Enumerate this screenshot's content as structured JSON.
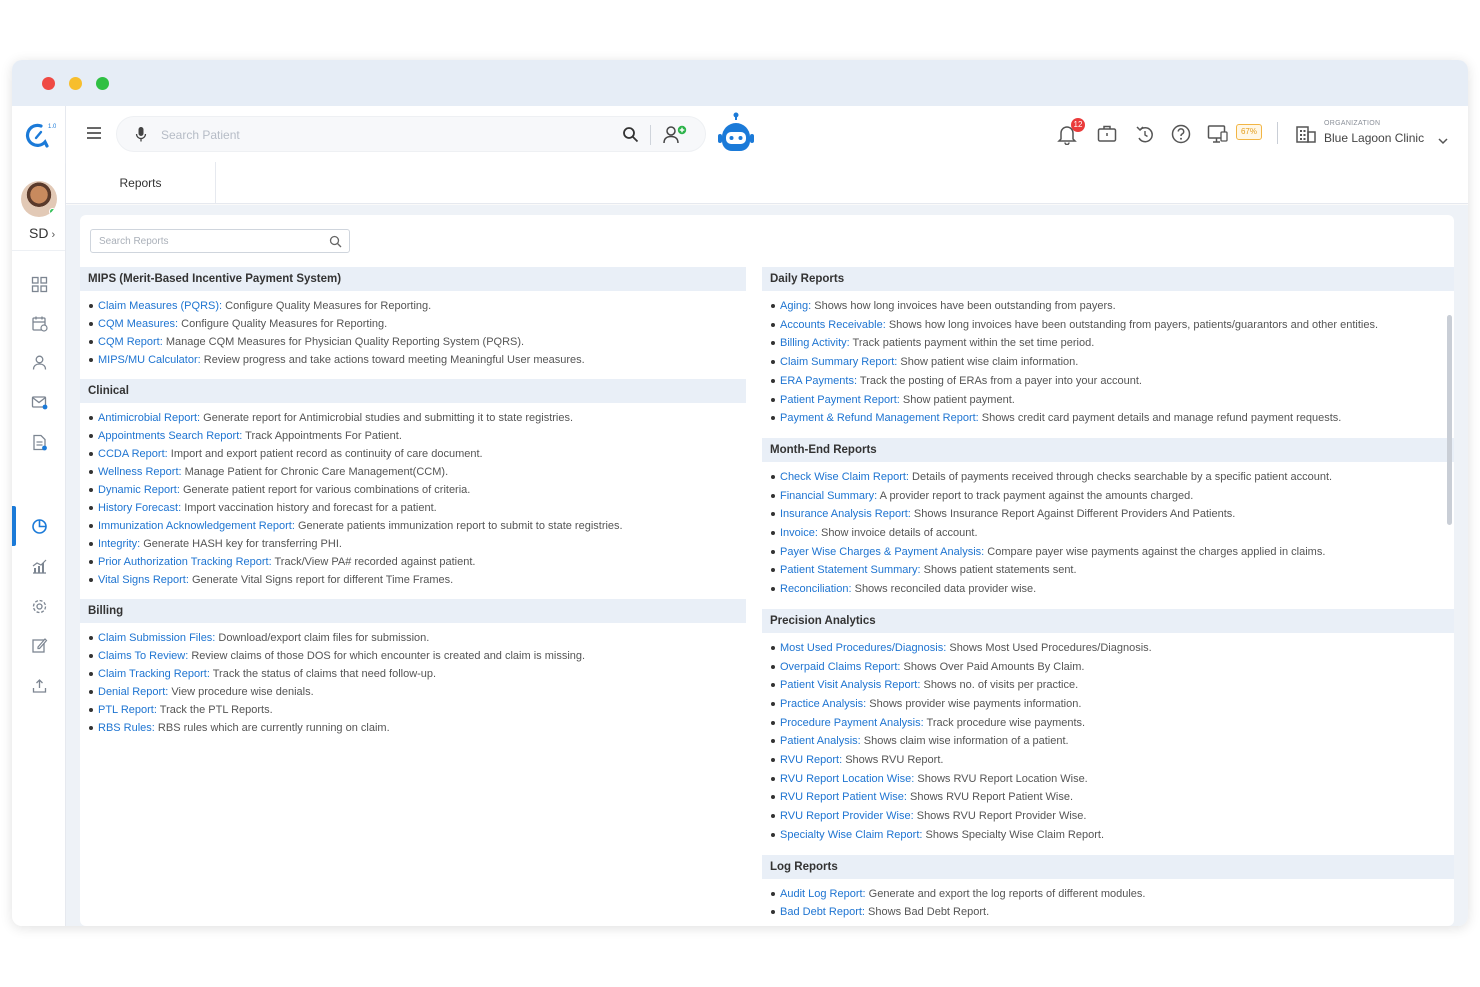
{
  "colors": {
    "accent": "#1e74d1",
    "section_header_bg": "#e9eff7",
    "content_bg": "#eef2f7",
    "notification_badge": "#ea3b3b"
  },
  "topbar": {
    "search_placeholder": "Search Patient",
    "notification_count": "12",
    "storage_percent": "67%",
    "organization_label": "ORGANIZATION",
    "organization_name": "Blue Lagoon Clinic"
  },
  "sidebar": {
    "user_initials": "SD",
    "nav_icons": [
      "dashboard-icon",
      "schedule-icon",
      "patient-icon",
      "messages-icon",
      "documents-icon",
      "reports-icon",
      "analytics-icon",
      "settings-icon",
      "edit-icon",
      "upload-icon"
    ],
    "active_item": "reports-icon"
  },
  "tabs": [
    {
      "label": "Reports"
    }
  ],
  "reports_search_placeholder": "Search Reports",
  "left_sections": [
    {
      "title": "MIPS (Merit-Based Incentive Payment System)",
      "items": [
        {
          "link": "Claim Measures (PQRS):",
          "desc": " Configure Quality Measures for Reporting."
        },
        {
          "link": "CQM Measures:",
          "desc": " Configure Quality Measures for Reporting."
        },
        {
          "link": "CQM Report:",
          "desc": " Manage CQM Measures for Physician Quality Reporting System (PQRS)."
        },
        {
          "link": "MIPS/MU Calculator:",
          "desc": " Review progress and take actions toward meeting Meaningful User measures."
        }
      ]
    },
    {
      "title": "Clinical",
      "items": [
        {
          "link": "Antimicrobial Report:",
          "desc": " Generate report for Antimicrobial studies and submitting it to state registries."
        },
        {
          "link": "Appointments Search Report:",
          "desc": " Track Appointments For Patient."
        },
        {
          "link": "CCDA Report:",
          "desc": " Import and export patient record as continuity of care document."
        },
        {
          "link": "Wellness Report:",
          "desc": " Manage Patient for Chronic Care Management(CCM)."
        },
        {
          "link": "Dynamic Report:",
          "desc": " Generate patient report for various combinations of criteria."
        },
        {
          "link": "History Forecast:",
          "desc": " Import vaccination history and forecast for a patient."
        },
        {
          "link": "Immunization Acknowledgement Report:",
          "desc": " Generate patients immunization report to submit to state registries."
        },
        {
          "link": "Integrity:",
          "desc": " Generate HASH key for transferring PHI."
        },
        {
          "link": "Prior Authorization Tracking Report:",
          "desc": " Track/View PA# recorded against patient."
        },
        {
          "link": "Vital Signs Report:",
          "desc": " Generate Vital Signs report for different Time Frames."
        }
      ]
    },
    {
      "title": "Billing",
      "items": [
        {
          "link": "Claim Submission Files:",
          "desc": " Download/export claim files for submission."
        },
        {
          "link": "Claims To Review:",
          "desc": " Review claims of those DOS for which encounter is created and claim is missing."
        },
        {
          "link": "Claim Tracking Report:",
          "desc": " Track the status of claims that need follow-up."
        },
        {
          "link": "Denial Report:",
          "desc": " View procedure wise denials."
        },
        {
          "link": "PTL Report:",
          "desc": " Track the PTL Reports."
        },
        {
          "link": "RBS Rules:",
          "desc": " RBS rules which are currently running on claim."
        }
      ]
    }
  ],
  "right_sections": [
    {
      "title": "Daily Reports",
      "items": [
        {
          "link": "Aging:",
          "desc": " Shows how long invoices have been outstanding from payers."
        },
        {
          "link": "Accounts Receivable:",
          "desc": " Shows how long invoices have been outstanding from payers, patients/guarantors and other entities."
        },
        {
          "link": "Billing Activity:",
          "desc": " Track patients payment within the set time period."
        },
        {
          "link": "Claim Summary Report:",
          "desc": " Show patient wise claim information."
        },
        {
          "link": "ERA Payments:",
          "desc": " Track the posting of ERAs from a payer into your account."
        },
        {
          "link": "Patient Payment Report:",
          "desc": " Show patient payment."
        },
        {
          "link": "Payment & Refund Management Report:",
          "desc": " Shows credit card payment details and manage refund payment requests."
        }
      ]
    },
    {
      "title": "Month-End Reports",
      "items": [
        {
          "link": "Check Wise Claim Report:",
          "desc": " Details of payments received through checks searchable by a specific patient account."
        },
        {
          "link": "Financial Summary:",
          "desc": " A provider report to track payment against the amounts charged."
        },
        {
          "link": "Insurance Analysis Report:",
          "desc": " Shows Insurance Report Against Different Providers And Patients."
        },
        {
          "link": "Invoice:",
          "desc": " Show invoice details of account."
        },
        {
          "link": "Payer Wise Charges & Payment Analysis:",
          "desc": " Compare payer wise payments against the charges applied in claims."
        },
        {
          "link": "Patient Statement Summary:",
          "desc": " Shows patient statements sent."
        },
        {
          "link": "Reconciliation:",
          "desc": " Shows reconciled data provider wise."
        }
      ]
    },
    {
      "title": "Precision Analytics",
      "items": [
        {
          "link": "Most Used Procedures/Diagnosis:",
          "desc": " Shows Most Used Procedures/Diagnosis."
        },
        {
          "link": "Overpaid Claims Report:",
          "desc": " Shows Over Paid Amounts By Claim."
        },
        {
          "link": "Patient Visit Analysis Report:",
          "desc": " Shows no. of visits per practice."
        },
        {
          "link": "Practice Analysis:",
          "desc": " Shows provider wise payments information."
        },
        {
          "link": "Procedure Payment Analysis:",
          "desc": " Track procedure wise payments."
        },
        {
          "link": "Patient Analysis:",
          "desc": " Shows claim wise information of a patient."
        },
        {
          "link": "RVU Report:",
          "desc": " Shows RVU Report."
        },
        {
          "link": "RVU Report Location Wise:",
          "desc": " Shows RVU Report Location Wise."
        },
        {
          "link": "RVU Report Patient Wise:",
          "desc": " Shows RVU Report Patient Wise."
        },
        {
          "link": "RVU Report Provider Wise:",
          "desc": " Shows RVU Report Provider Wise."
        },
        {
          "link": "Specialty Wise Claim Report:",
          "desc": " Shows Specialty Wise Claim Report."
        }
      ]
    },
    {
      "title": "Log Reports",
      "items": [
        {
          "link": "Audit Log Report:",
          "desc": " Generate and export the log reports of different modules."
        },
        {
          "link": "Bad Debt Report:",
          "desc": " Shows Bad Debt Report."
        }
      ]
    }
  ]
}
